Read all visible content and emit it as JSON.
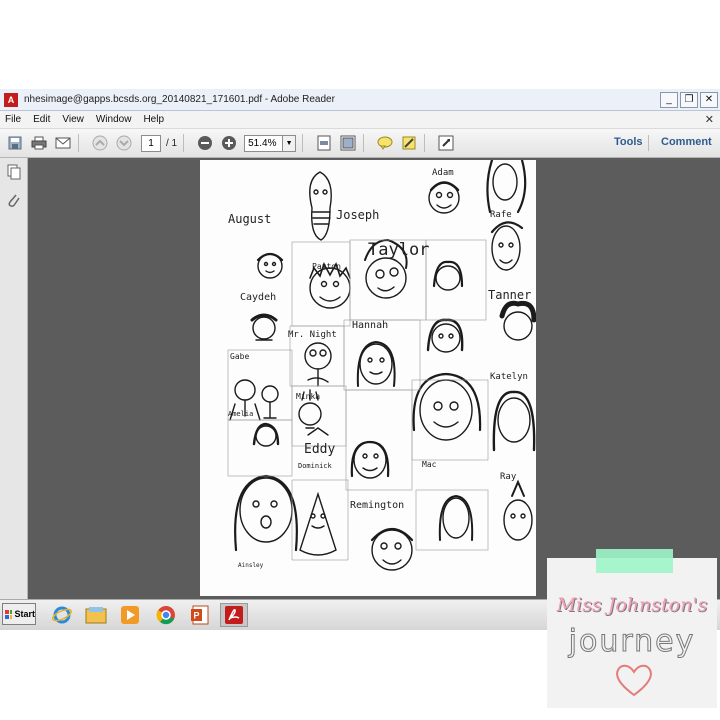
{
  "window": {
    "title": "nhesimage@gapps.bcsds.org_20140821_171601.pdf - Adobe Reader",
    "controls": [
      "_",
      "❐",
      "✕"
    ]
  },
  "menu": [
    "File",
    "Edit",
    "View",
    "Window",
    "Help"
  ],
  "toolbar": {
    "page_current": "1",
    "page_total": "/ 1",
    "zoom": "51.4%",
    "tools_label": "Tools",
    "comment_label": "Comment"
  },
  "document": {
    "name_labels": [
      "Adam",
      "August",
      "Joseph",
      "Rafe",
      "Taylor",
      "Paxton",
      "Tanner",
      "Caydeh",
      "Mr. Night",
      "Hannah",
      "Gabe",
      "Amelia",
      "Katelyn",
      "Minka",
      "Eddy",
      "Dominick",
      "Mac",
      "Ray",
      "Remington",
      "Ainsley"
    ]
  },
  "taskbar": {
    "start_label": "Start",
    "apps": [
      "internet-explorer-icon",
      "file-explorer-icon",
      "media-player-icon",
      "chrome-icon",
      "powerpoint-icon",
      "adobe-reader-icon"
    ]
  },
  "badge": {
    "line1": "Miss Johnston's",
    "line2": "journey",
    "accent": "#f2a0b8",
    "tape_color": "#9ff5c9"
  }
}
